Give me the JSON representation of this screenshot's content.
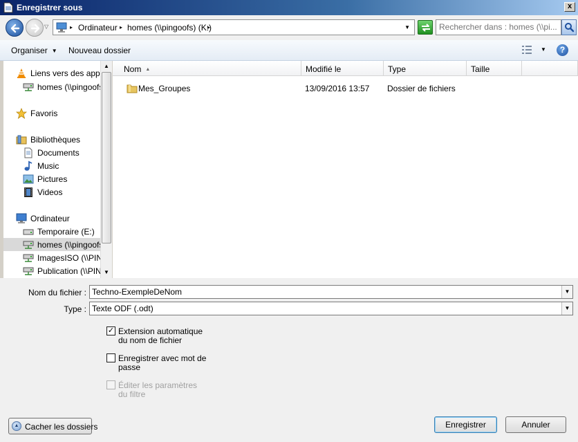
{
  "window": {
    "title": "Enregistrer sous",
    "close_label": "x"
  },
  "address": {
    "crumbs": [
      "Ordinateur",
      "homes (\\\\pingoofs) (K:)"
    ],
    "search_placeholder": "Rechercher dans : homes (\\\\pi..."
  },
  "toolbar": {
    "organize": "Organiser",
    "new_folder": "Nouveau dossier",
    "help": "?"
  },
  "nav": {
    "items": [
      {
        "label": "Liens vers des applica",
        "icon": "vlc-icon"
      },
      {
        "label": "homes (\\\\pingoofs)",
        "icon": "network-drive-icon"
      },
      {
        "label": "Favoris",
        "icon": "star-icon"
      },
      {
        "label": "Bibliothèques",
        "icon": "libraries-icon"
      },
      {
        "label": "Documents",
        "icon": "document-icon"
      },
      {
        "label": "Music",
        "icon": "music-icon"
      },
      {
        "label": "Pictures",
        "icon": "pictures-icon"
      },
      {
        "label": "Videos",
        "icon": "video-icon"
      },
      {
        "label": "Ordinateur",
        "icon": "computer-icon"
      },
      {
        "label": "Temporaire (E:)",
        "icon": "drive-icon"
      },
      {
        "label": "homes (\\\\pingoofs)",
        "icon": "network-drive-icon",
        "selected": true
      },
      {
        "label": "ImagesISO (\\\\PING",
        "icon": "network-drive-icon"
      },
      {
        "label": "Publication (\\\\PING",
        "icon": "network-drive-icon"
      }
    ]
  },
  "files": {
    "columns": [
      "Nom",
      "Modifié le",
      "Type",
      "Taille"
    ],
    "rows": [
      {
        "name": "Mes_Groupes",
        "modified": "13/09/2016 13:57",
        "type": "Dossier de fichiers",
        "size": ""
      }
    ]
  },
  "form": {
    "filename_label": "Nom du fichier :",
    "filename_value": "Techno-ExempleDeNom",
    "type_label": "Type :",
    "type_value": "Texte ODF (.odt)",
    "check_ext": {
      "label": "Extension automatique du nom de fichier",
      "checked": true
    },
    "check_password": {
      "label": "Enregistrer avec mot de passe",
      "checked": false
    },
    "check_filter": {
      "label": "Éditer les paramètres du filtre",
      "checked": false,
      "disabled": true
    },
    "save_button": "Enregistrer",
    "cancel_button": "Annuler",
    "hide_folders_button": "Cacher les dossiers"
  }
}
